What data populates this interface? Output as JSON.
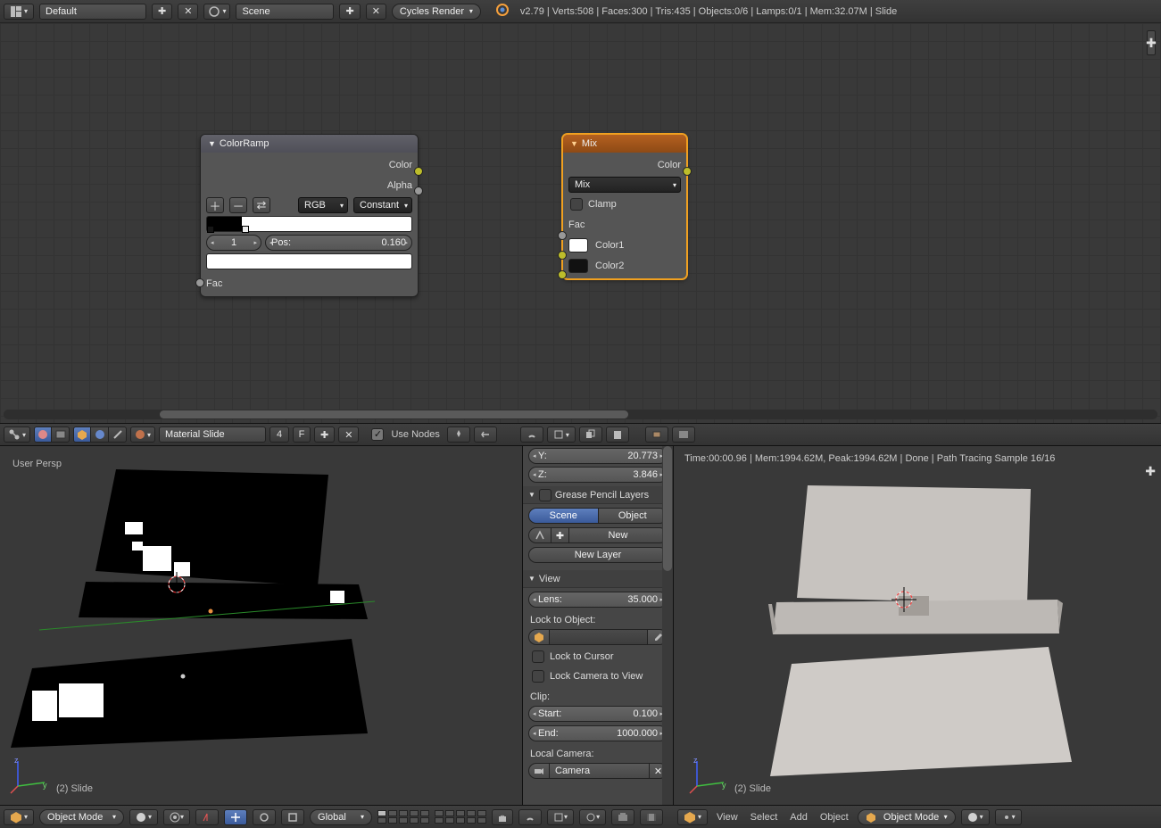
{
  "topbar": {
    "layout_label": "Default",
    "scene_label": "Scene",
    "engine_label": "Cycles Render",
    "stats": "v2.79 | Verts:508 | Faces:300 | Tris:435 | Objects:0/6 | Lamps:0/1 | Mem:32.07M | Slide"
  },
  "node_editor": {
    "color_ramp": {
      "title": "ColorRamp",
      "out_color": "Color",
      "out_alpha": "Alpha",
      "mode": "RGB",
      "interp": "Constant",
      "index": "1",
      "pos_label": "Pos:",
      "pos_value": "0.160",
      "in_fac": "Fac"
    },
    "mix": {
      "title": "Mix",
      "out_color": "Color",
      "blend": "Mix",
      "clamp_label": "Clamp",
      "fac_label": "Fac",
      "color1_label": "Color1",
      "color2_label": "Color2"
    },
    "header": {
      "material_label": "Material Slide",
      "users": "4",
      "fake": "F",
      "use_nodes": "Use Nodes"
    }
  },
  "view_left": {
    "persp": "User Persp",
    "obj_label": "(2) Slide"
  },
  "npanel": {
    "y_label": "Y:",
    "y_val": "20.773",
    "z_label": "Z:",
    "z_val": "3.846",
    "gp_title": "Grease Pencil Layers",
    "scene": "Scene",
    "object": "Object",
    "new": "New",
    "new_layer": "New Layer",
    "view_title": "View",
    "lens_label": "Lens:",
    "lens_val": "35.000",
    "lock_obj": "Lock to Object:",
    "lock_cursor": "Lock to Cursor",
    "lock_cam": "Lock Camera to View",
    "clip": "Clip:",
    "start_label": "Start:",
    "start_val": "0.100",
    "end_label": "End:",
    "end_val": "1000.000",
    "local_cam": "Local Camera:",
    "camera": "Camera"
  },
  "view_right": {
    "render_info": "Time:00:00.96 | Mem:1994.62M, Peak:1994.62M | Done | Path Tracing Sample 16/16",
    "obj_label": "(2) Slide"
  },
  "view3d_hdr": {
    "mode": "Object Mode",
    "orient": "Global",
    "menu_view": "View",
    "menu_select": "Select",
    "menu_add": "Add",
    "menu_object": "Object"
  }
}
